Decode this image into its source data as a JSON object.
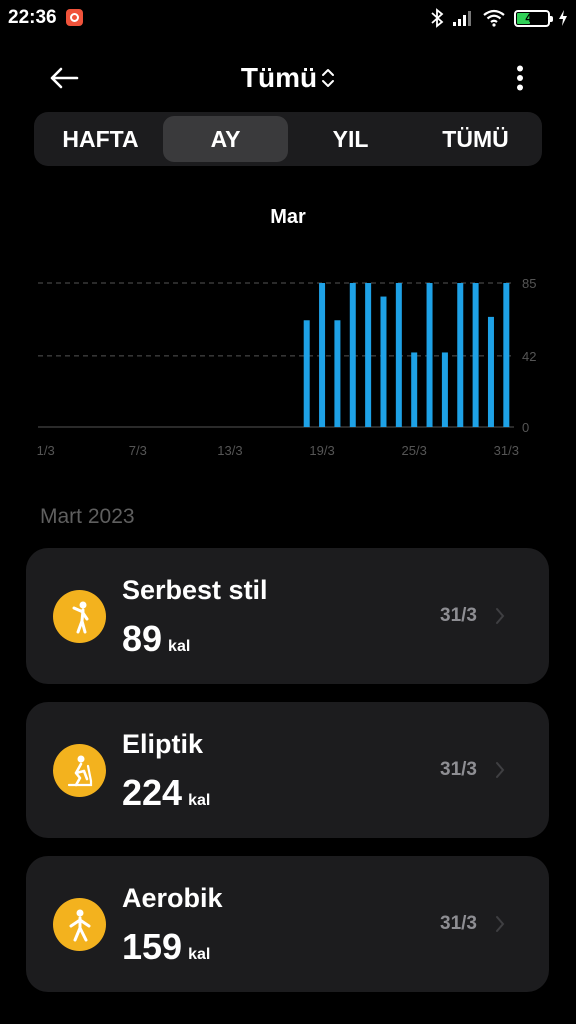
{
  "status_bar": {
    "time": "22:36",
    "battery": "41"
  },
  "header": {
    "title": "Tümü"
  },
  "tabs": [
    {
      "label": "HAFTA",
      "active": false
    },
    {
      "label": "AY",
      "active": true
    },
    {
      "label": "YIL",
      "active": false
    },
    {
      "label": "TÜMÜ",
      "active": false
    }
  ],
  "chart_data": {
    "type": "bar",
    "title": "Mar",
    "categories": [
      "1/3",
      "2/3",
      "3/3",
      "4/3",
      "5/3",
      "6/3",
      "7/3",
      "8/3",
      "9/3",
      "10/3",
      "11/3",
      "12/3",
      "13/3",
      "14/3",
      "15/3",
      "16/3",
      "17/3",
      "18/3",
      "19/3",
      "20/3",
      "21/3",
      "22/3",
      "23/3",
      "24/3",
      "25/3",
      "26/3",
      "27/3",
      "28/3",
      "29/3",
      "30/3",
      "31/3"
    ],
    "values": [
      0,
      0,
      0,
      0,
      0,
      0,
      0,
      0,
      0,
      0,
      0,
      0,
      0,
      0,
      0,
      0,
      0,
      63,
      85,
      63,
      85,
      85,
      77,
      85,
      44,
      85,
      44,
      85,
      85,
      65,
      85
    ],
    "x_tick_labels": [
      "1/3",
      "7/3",
      "13/3",
      "19/3",
      "25/3",
      "31/3"
    ],
    "y_tick_labels": [
      "0",
      "42",
      "85"
    ],
    "ylim": [
      0,
      85
    ],
    "grid": true,
    "color": "#1ea1e6"
  },
  "list": {
    "month": "Mart 2023",
    "items": [
      {
        "name": "Serbest stil",
        "value": "89",
        "unit": "kal",
        "date": "31/3",
        "icon": "freestyle-icon"
      },
      {
        "name": "Eliptik",
        "value": "224",
        "unit": "kal",
        "date": "31/3",
        "icon": "elliptical-icon"
      },
      {
        "name": "Aerobik",
        "value": "159",
        "unit": "kal",
        "date": "31/3",
        "icon": "aerobics-icon"
      }
    ]
  },
  "colors": {
    "background": "#000000",
    "card": "#1c1c1e",
    "accent": "#f3b21e",
    "bar": "#1ea1e6"
  }
}
